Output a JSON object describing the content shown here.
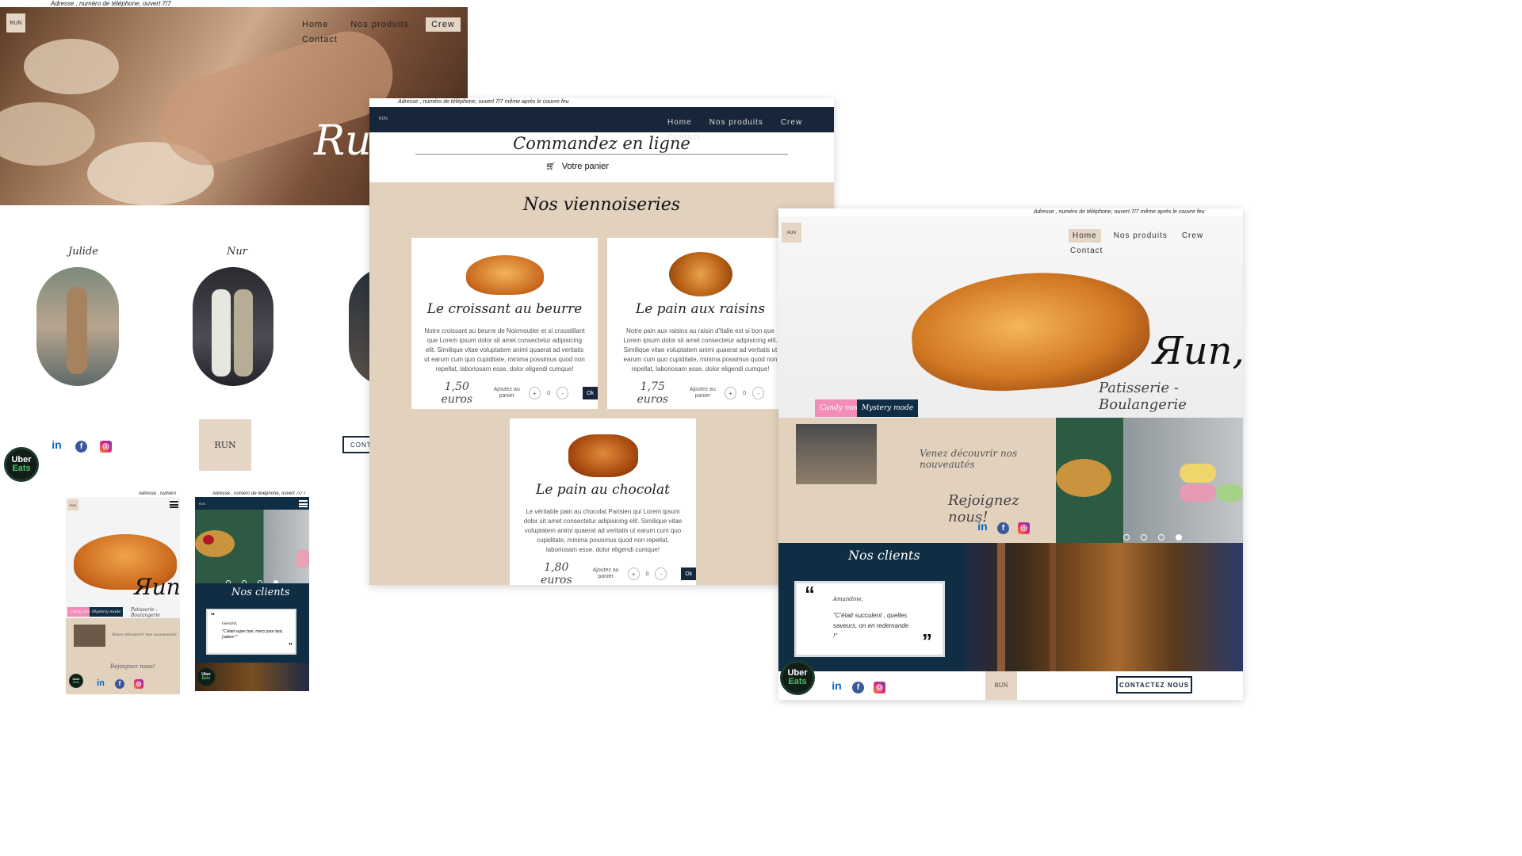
{
  "address": {
    "short": "Adresse , numéro de téléphone, ouvert 7/7",
    "full": "Adresse , numéro de téléphone, ouvert 7/7 même après le couvre feu",
    "mobile": "Adresse , numéro",
    "mobile2": "Adresse , numéro de téléphone, ouvert 7/7 r"
  },
  "logo_text": "RUN",
  "nav": {
    "home": "Home",
    "products": "Nos produits",
    "crew": "Crew",
    "contact": "Contact"
  },
  "hero": {
    "brand": "Run",
    "brand_comma": "Яun,",
    "subtitle": "Patisserie - Boulangerie"
  },
  "crew": {
    "members": [
      "Julide",
      "Nur"
    ]
  },
  "contact_button": "CONTACTEZ NOUS",
  "contact_cut": "CONT",
  "uber": {
    "l1": "Uber",
    "l2": "Eats"
  },
  "order": {
    "title": "Commandez en ligne",
    "cart": "Votre panier",
    "section": "Nos viennoiseries",
    "add_label": "Ajoutez au panier",
    "ok": "Ok",
    "qty": "0",
    "plus": "+",
    "minus": "-",
    "products": [
      {
        "name": "Le croissant au beurre",
        "desc": "Notre croissant au beurre de Noirmoutier et si croustillant que Lorem ipsum dolor sit amet consectetur adipisicing elit. Similique vitae voluptatem animi quaerat ad veritatis ut earum cum quo cupiditate, minima possimus quod non repellat, laboriosam esse, dolor eligendi cumque!",
        "price": "1,50 euros"
      },
      {
        "name": "Le pain aux raisins",
        "desc": "Notre pain aux raisins au raisin d'Italie est si bon que Lorem ipsum dolor sit amet consectetur adipisicing elit. Similique vitae voluptatem animi quaerat ad veritatis ut earum cum quo cupiditate, minima possimus quod non repellat, laboriosam esse, dolor eligendi cumque!",
        "price": "1,75 euros"
      },
      {
        "name": "Le pain au chocolat",
        "desc": "Le véritable pain au chocolat Parisien qui Lorem ipsum dolor sit amet consectetur adipisicing elit. Similique vitae voluptatem animi quaerat ad veritatis ut earum cum quo cupiditate, minima possimus quod non repellat, laboriosam esse, dolor eligendi cumque!",
        "price": "1,80 euros"
      }
    ]
  },
  "modes": {
    "candy": "Candy mode",
    "mystery": "Mystery mode"
  },
  "promo": {
    "discover": "Venez découvrir nos nouveautés",
    "join": "Rejoignez nous!"
  },
  "clients": {
    "title": "Nos clients",
    "review1_name": "Amandine,",
    "review1_text": "\"C'était succulent , quelles saveurs, on en redemande !\"",
    "review2_name": "Gérard,",
    "review2_text": "\"C'était super bon, merci pour tout, j'adore !\""
  },
  "social": {
    "linkedin": "in",
    "facebook": "f",
    "instagram": "◎"
  },
  "colors": {
    "navy": "#17263b",
    "beige": "#e2d1bd",
    "pink": "#f28cb8",
    "teal_dark": "#0f2e44"
  }
}
